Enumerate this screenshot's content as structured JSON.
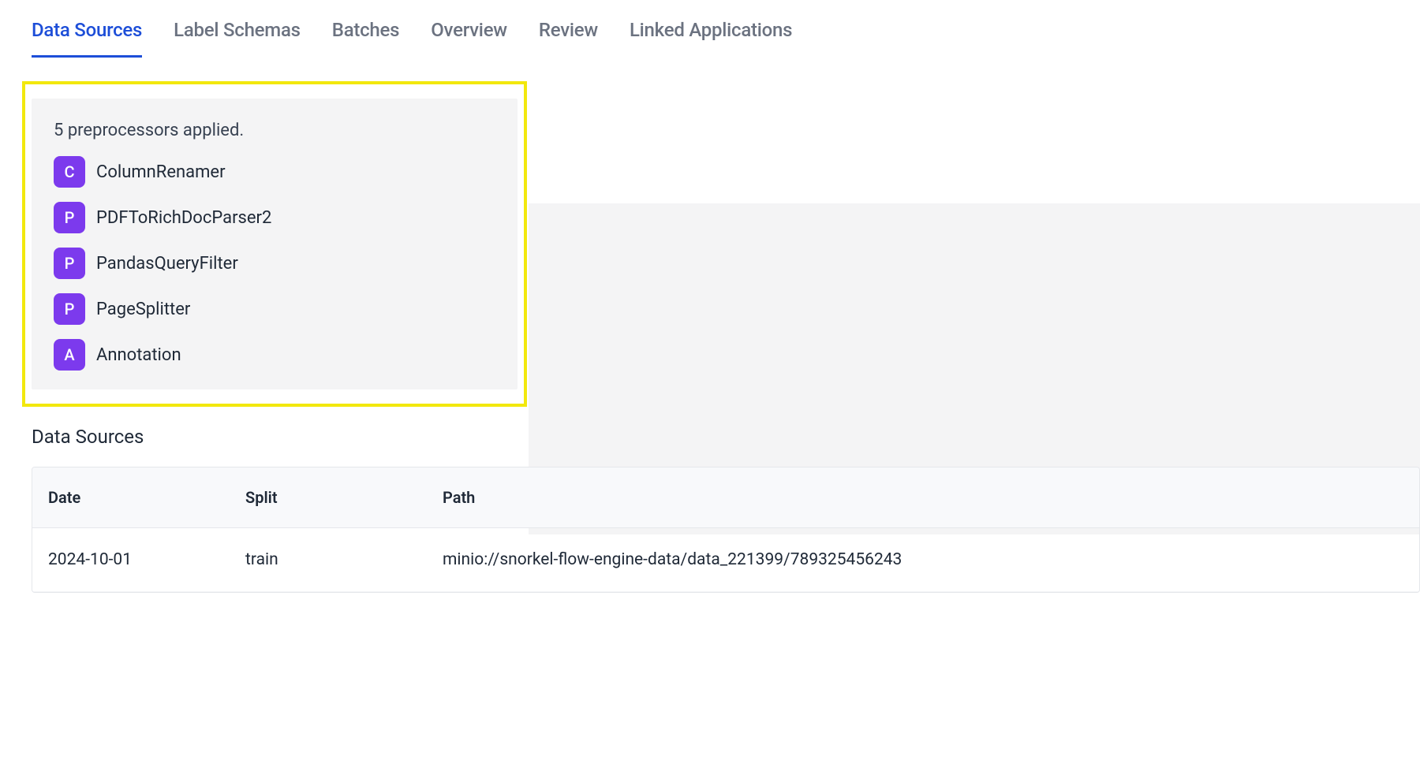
{
  "tabs": {
    "data_sources": "Data Sources",
    "label_schemas": "Label Schemas",
    "batches": "Batches",
    "overview": "Overview",
    "review": "Review",
    "linked_applications": "Linked Applications",
    "active": "data_sources"
  },
  "preprocessors": {
    "summary": "5 preprocessors applied.",
    "items": [
      {
        "badge": "C",
        "label": "ColumnRenamer"
      },
      {
        "badge": "P",
        "label": "PDFToRichDocParser2"
      },
      {
        "badge": "P",
        "label": "PandasQueryFilter"
      },
      {
        "badge": "P",
        "label": "PageSplitter"
      },
      {
        "badge": "A",
        "label": "Annotation"
      }
    ]
  },
  "section": {
    "title": "Data Sources"
  },
  "table": {
    "headers": {
      "date": "Date",
      "split": "Split",
      "path": "Path"
    },
    "rows": [
      {
        "date": "2024-10-01",
        "split": "train",
        "path": "minio://snorkel-flow-engine-data/data_221399/789325456243"
      }
    ]
  }
}
